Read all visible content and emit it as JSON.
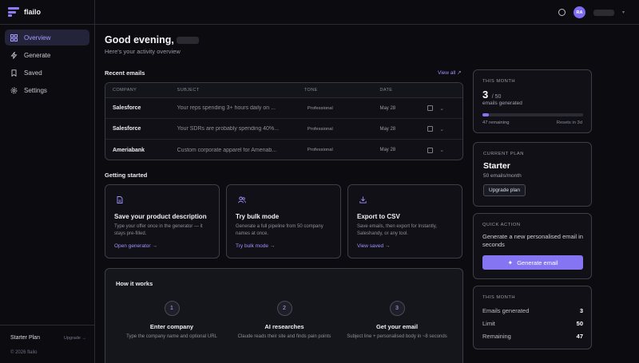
{
  "app": {
    "name": "flailo"
  },
  "sidebar": {
    "items": [
      {
        "label": "Overview",
        "icon": "grid-icon",
        "active": true
      },
      {
        "label": "Generate",
        "icon": "bolt-icon"
      },
      {
        "label": "Saved",
        "icon": "bookmark-icon"
      },
      {
        "label": "Settings",
        "icon": "gear-icon"
      }
    ],
    "plan_label": "Starter Plan",
    "upgrade_label": "Upgrade →",
    "copyright": "© 2026 flailo"
  },
  "topbar": {
    "avatar_initials": "RA"
  },
  "header": {
    "greeting": "Good evening,",
    "subtitle": "Here's your activity overview"
  },
  "recent": {
    "title": "Recent emails",
    "view_all": "View all ↗",
    "columns": [
      "COMPANY",
      "SUBJECT",
      "TONE",
      "DATE"
    ],
    "rows": [
      {
        "company": "Salesforce",
        "subject": "Your reps spending 3+ hours daily on ...",
        "tone": "Professional",
        "date": "May 28"
      },
      {
        "company": "Salesforce",
        "subject": "Your SDRs are probably spending 40%...",
        "tone": "Professional",
        "date": "May 28"
      },
      {
        "company": "Ameriabank",
        "subject": "Custom corporate apparel for Ameriab...",
        "tone": "Professional",
        "date": "May 28"
      }
    ]
  },
  "getting_started": {
    "title": "Getting started",
    "cards": [
      {
        "icon": "document-icon",
        "title": "Save your product description",
        "desc": "Type your offer once in the generator — it stays pre-filled.",
        "link": "Open generator →"
      },
      {
        "icon": "users-icon",
        "title": "Try bulk mode",
        "desc": "Generate a full pipeline from 50 company names at once.",
        "link": "Try bulk mode →"
      },
      {
        "icon": "download-icon",
        "title": "Export to CSV",
        "desc": "Save emails, then export for Instantly, Saleshandy, or any tool.",
        "link": "View saved →"
      }
    ]
  },
  "how": {
    "title": "How it works",
    "steps": [
      {
        "num": "1",
        "title": "Enter company",
        "desc": "Type the company name and optional URL"
      },
      {
        "num": "2",
        "title": "AI researches",
        "desc": "Claude reads their site and finds pain points"
      },
      {
        "num": "3",
        "title": "Get your email",
        "desc": "Subject line + personalised body in ~8 seconds"
      }
    ]
  },
  "usage": {
    "label": "THIS MONTH",
    "used": "3",
    "limit_text": "/ 50",
    "caption": "emails generated",
    "progress_fraction": 0.06,
    "remaining_text": "47 remaining",
    "resets_text": "Resets in 3d"
  },
  "plan": {
    "label": "CURRENT PLAN",
    "name": "Starter",
    "detail": "50 emails/month",
    "button": "Upgrade plan"
  },
  "quick_action": {
    "label": "QUICK ACTION",
    "text": "Generate a new personalised email in seconds",
    "button": "Generate email"
  },
  "stats": {
    "label": "THIS MONTH",
    "rows": [
      {
        "label": "Emails generated",
        "value": "3"
      },
      {
        "label": "Limit",
        "value": "50"
      },
      {
        "label": "Remaining",
        "value": "47"
      }
    ]
  },
  "colors": {
    "accent": "#8575f2",
    "background": "#0b0b10",
    "card_border": "#3e3e48"
  }
}
